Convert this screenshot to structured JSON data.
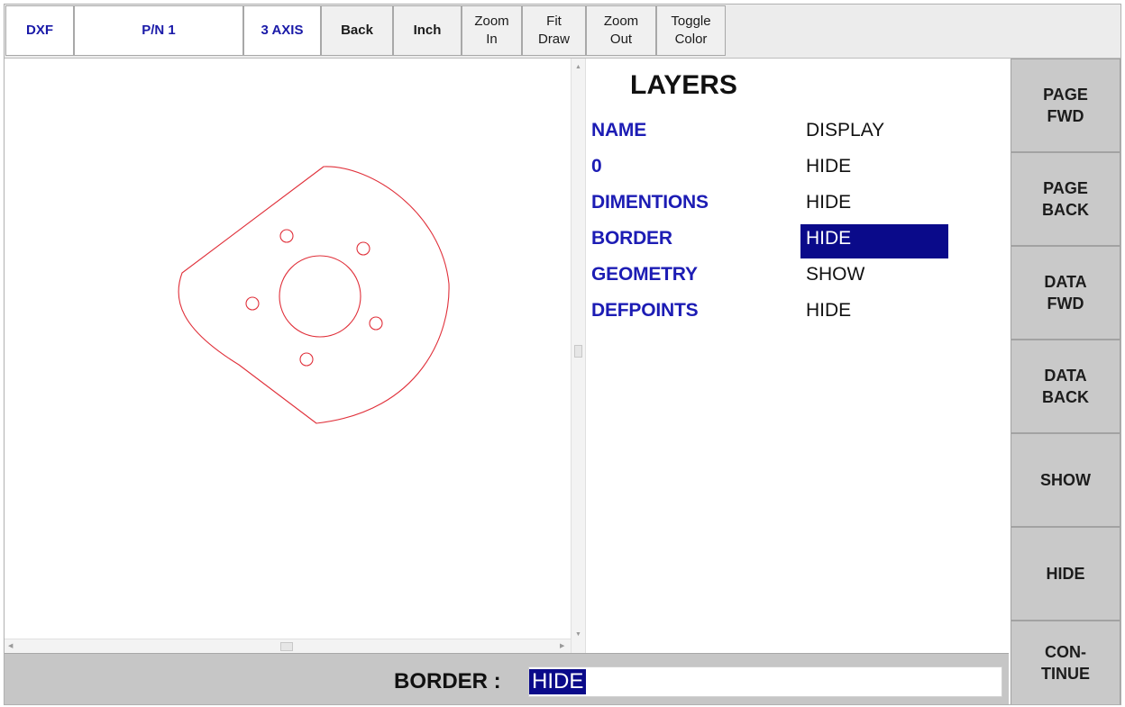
{
  "toolbar": {
    "dxf": "DXF",
    "part_number": "P/N 1",
    "axis": "3 AXIS",
    "back": "Back",
    "units": "Inch",
    "zoom_in": "Zoom\nIn",
    "fit_draw": "Fit\nDraw",
    "zoom_out": "Zoom\nOut",
    "toggle_color": "Toggle\nColor"
  },
  "drawing": {
    "stroke_color": "#e0303a"
  },
  "layers": {
    "title": "LAYERS",
    "header": {
      "name": "NAME",
      "display": "DISPLAY"
    },
    "rows": [
      {
        "name": "0",
        "display": "HIDE"
      },
      {
        "name": "DIMENTIONS",
        "display": "HIDE"
      },
      {
        "name": "BORDER",
        "display": "HIDE",
        "selected": true
      },
      {
        "name": "GEOMETRY",
        "display": "SHOW"
      },
      {
        "name": "DEFPOINTS",
        "display": "HIDE"
      }
    ]
  },
  "side_buttons": {
    "page_fwd": "PAGE\nFWD",
    "page_back": "PAGE\nBACK",
    "data_fwd": "DATA\nFWD",
    "data_back": "DATA\nBACK",
    "show": "SHOW",
    "hide": "HIDE",
    "continue": "CON-\nTINUE"
  },
  "status": {
    "label": "BORDER :",
    "value": "HIDE"
  },
  "colors": {
    "accent_blue": "#1c1cb4",
    "selection": "#0a0a8a",
    "panel_gray": "#c9c9c9"
  }
}
